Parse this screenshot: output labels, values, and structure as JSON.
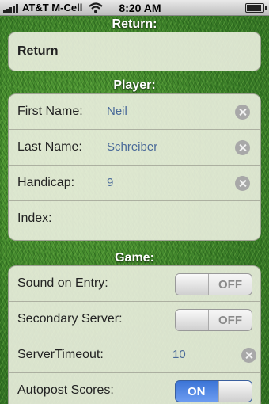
{
  "status_bar": {
    "carrier": "AT&T M-Cell",
    "time": "8:20 AM",
    "icons": [
      "signal-icon",
      "wifi-icon",
      "battery-icon"
    ]
  },
  "sections": {
    "return": {
      "title": "Return:",
      "button_label": "Return"
    },
    "player": {
      "title": "Player:",
      "fields": [
        {
          "label": "First Name:",
          "value": "Neil",
          "clearable": true
        },
        {
          "label": "Last Name:",
          "value": "Schreiber",
          "clearable": true
        },
        {
          "label": "Handicap:",
          "value": "9",
          "clearable": true
        },
        {
          "label": "Index:",
          "value": ""
        }
      ]
    },
    "game": {
      "title": "Game:",
      "sound_on_entry": {
        "label": "Sound on Entry:",
        "state": "OFF"
      },
      "secondary_server": {
        "label": "Secondary Server:",
        "state": "OFF"
      },
      "server_timeout": {
        "label": "ServerTimeout:",
        "value": "10"
      },
      "autopost_scores": {
        "label": "Autopost Scores:",
        "state": "ON"
      }
    }
  },
  "colors": {
    "toggle_on": "#3b74d6",
    "value_text": "#4a6a99",
    "section_title": "#ffffff"
  }
}
